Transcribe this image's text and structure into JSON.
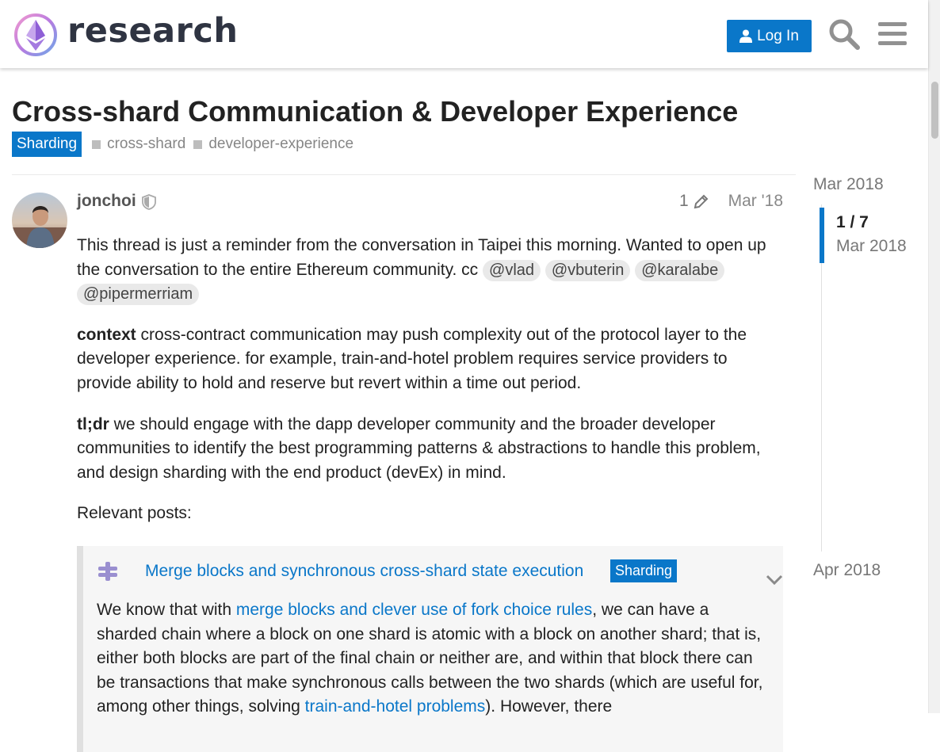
{
  "header": {
    "site_name": "research",
    "login_label": "Log In",
    "icons": [
      "logo-icon",
      "user-icon",
      "search-icon",
      "hamburger-menu-icon"
    ]
  },
  "topic": {
    "title": "Cross-shard Communication & Developer Experience",
    "category": "Sharding",
    "tags": [
      "cross-shard",
      "developer-experience"
    ]
  },
  "post": {
    "author": "jonchoi",
    "edit_count": "1",
    "date": "Mar '18",
    "para1_text": "This thread is just a reminder from the conversation in Taipei this morning. Wanted to open up the conversation to the entire Ethereum community. cc ",
    "mentions": [
      "@vlad",
      "@vbuterin",
      "@karalabe",
      "@pipermerriam"
    ],
    "context_label": "context",
    "context_text": " cross-contract communication may push complexity out of the protocol layer to the developer experience. for example, train-and-hotel problem requires service providers to provide ability to hold and reserve but revert within a time out period.",
    "tldr_label": "tl;dr",
    "tldr_text": " we should engage with the dapp developer community and the broader developer communities to identify the best programming patterns & abstractions to handle this problem, and design sharding with the end product (devEx) in mind.",
    "relevant_label": "Relevant posts:"
  },
  "onebox": {
    "title": "Merge blocks and synchronous cross-shard state execution",
    "category": "Sharding",
    "text1": "We know that with ",
    "link1": "merge blocks and clever use of fork choice rules",
    "text2": ", we can have a sharded chain where a block on one shard is atomic with a block on another shard; that is, either both blocks are part of the final chain or neither are, and within that block there can be transactions that make synchronous calls between the two shards (which are useful for, among other things, solving ",
    "link2": "train-and-hotel problems",
    "text3": "). However, there"
  },
  "timeline": {
    "start": "Mar 2018",
    "position": "1 / 7",
    "current_date": "Mar 2018",
    "end": "Apr 2018"
  },
  "colors": {
    "accent": "#0a77c9",
    "text": "#222222",
    "muted": "#888888"
  }
}
